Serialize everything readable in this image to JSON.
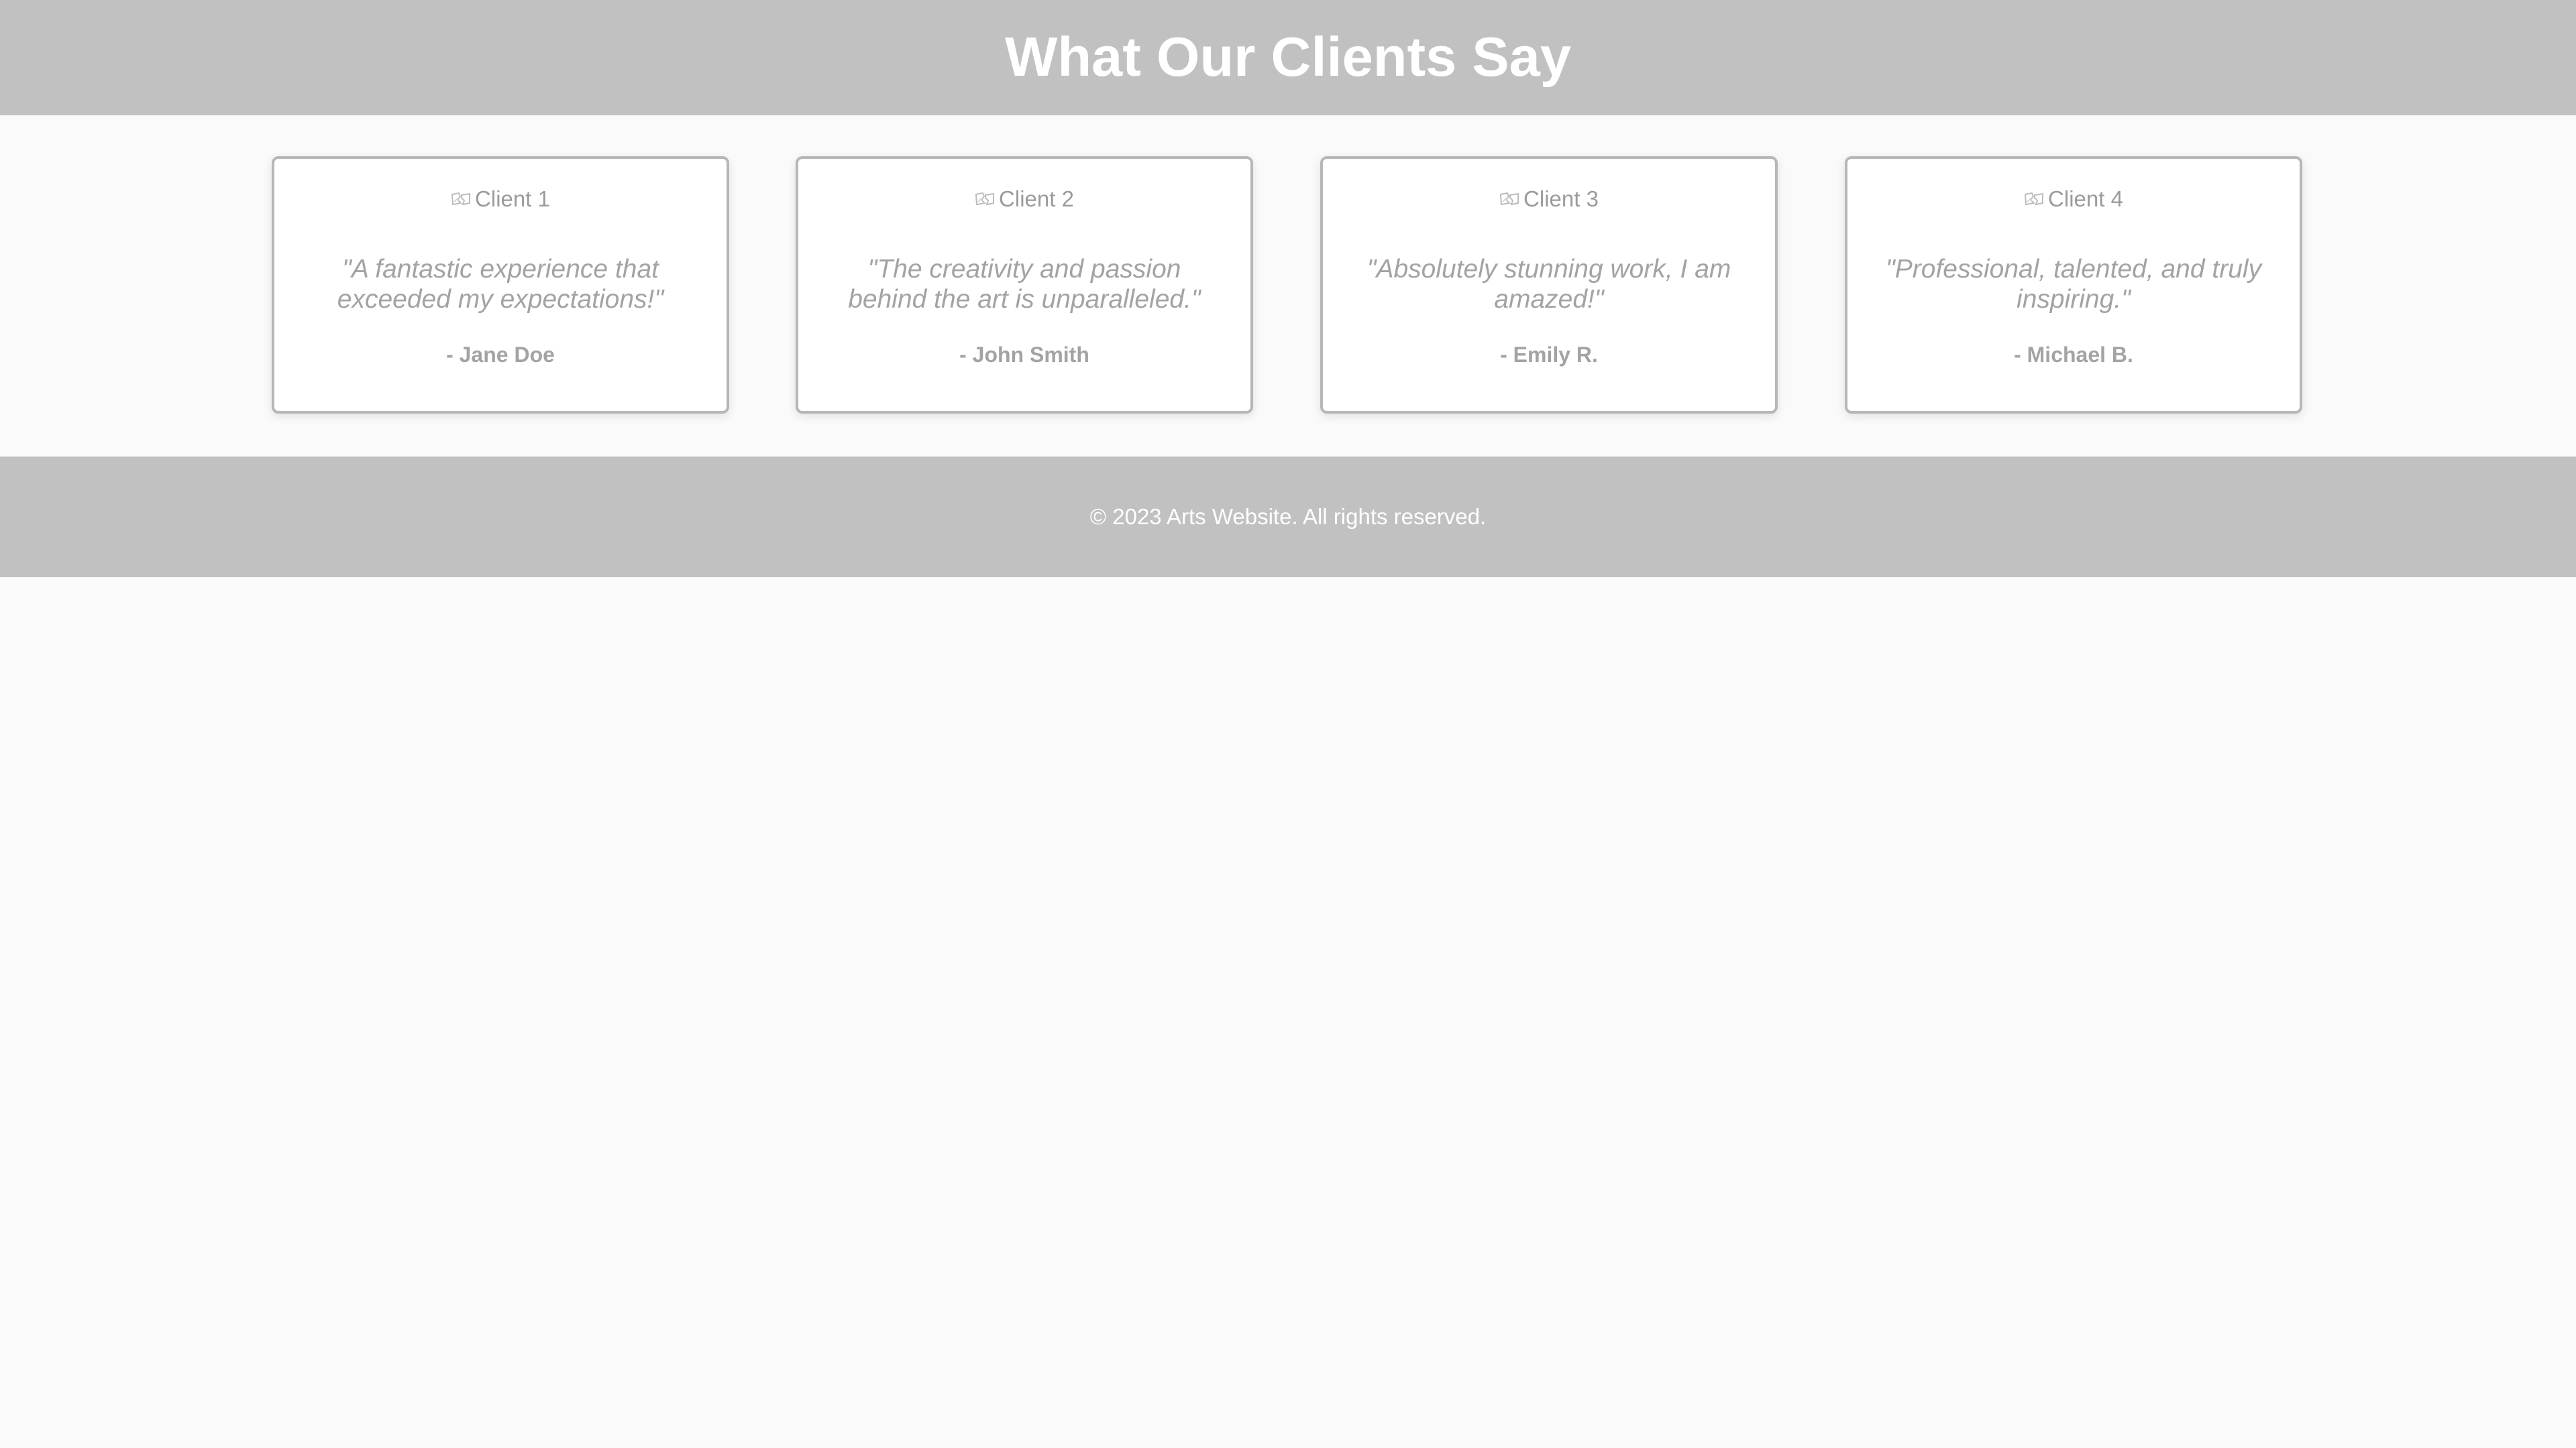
{
  "header": {
    "title": "What Our Clients Say"
  },
  "testimonials": [
    {
      "image_alt": "Client 1",
      "quote": "\"A fantastic experience that exceeded my expectations!\"",
      "author": "- Jane Doe"
    },
    {
      "image_alt": "Client 2",
      "quote": "\"The creativity and passion behind the art is unparalleled.\"",
      "author": "- John Smith"
    },
    {
      "image_alt": "Client 3",
      "quote": "\"Absolutely stunning work, I am amazed!\"",
      "author": "- Emily R."
    },
    {
      "image_alt": "Client 4",
      "quote": "\"Professional, talented, and truly inspiring.\"",
      "author": "- Michael B."
    }
  ],
  "footer": {
    "copyright": "© 2023 Arts Website. All rights reserved."
  },
  "colors": {
    "header_bg": "#c1c1c1",
    "page_bg": "#fafafa",
    "card_border": "#b7b7b7",
    "muted_text": "#a3a3a3"
  }
}
